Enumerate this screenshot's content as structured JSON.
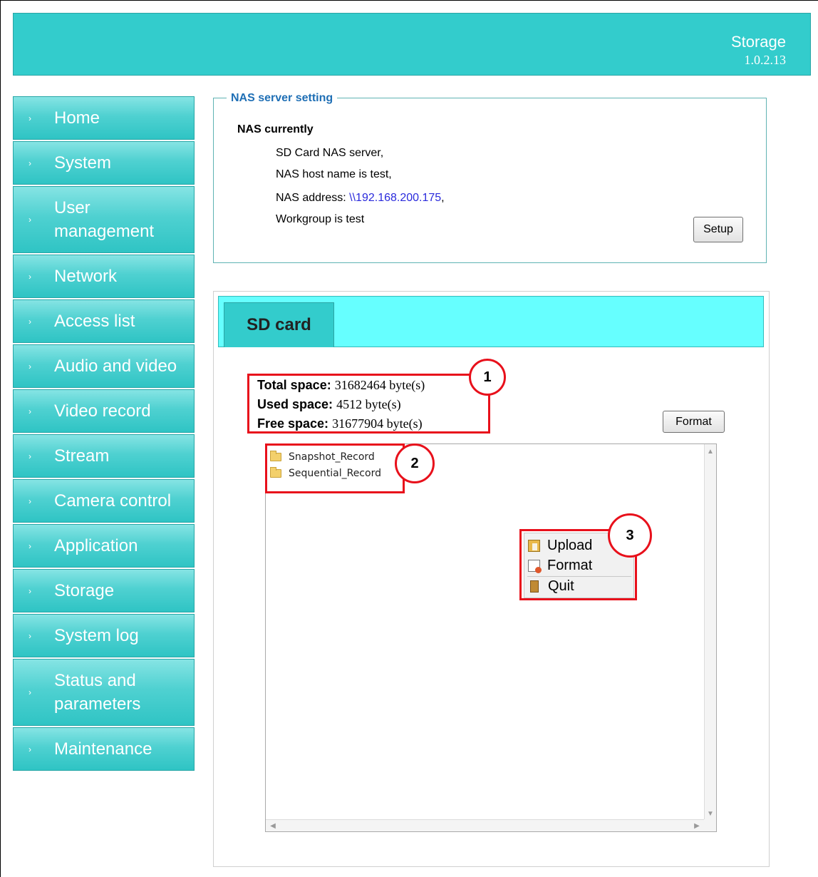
{
  "header": {
    "title": "Storage",
    "version": "1.0.2.13",
    "bg_color": "#33cccc"
  },
  "sidebar": {
    "items": [
      {
        "label": "Home"
      },
      {
        "label": "System"
      },
      {
        "label": "User management"
      },
      {
        "label": "Network"
      },
      {
        "label": "Access list"
      },
      {
        "label": "Audio and video"
      },
      {
        "label": "Video record"
      },
      {
        "label": "Stream"
      },
      {
        "label": "Camera control"
      },
      {
        "label": "Application"
      },
      {
        "label": "Storage"
      },
      {
        "label": "System log"
      },
      {
        "label": "Status and parameters"
      },
      {
        "label": "Maintenance"
      }
    ],
    "chevron_icon": "chevron-right-icon"
  },
  "nas": {
    "legend": "NAS server setting",
    "heading": "NAS currently",
    "line1": "SD Card NAS server,",
    "line2": "NAS host name is test,",
    "line3_prefix": "NAS address: ",
    "line3_link": "\\\\192.168.200.175",
    "line3_suffix": ",",
    "line4": "Workgroup is test",
    "setup_button": "Setup"
  },
  "sd_card": {
    "tab_label": "SD card",
    "total_label": "Total space:",
    "total_value": "31682464 byte(s)",
    "used_label": "Used space:",
    "used_value": "4512 byte(s)",
    "free_label": "Free space:",
    "free_value": "31677904 byte(s)",
    "format_button": "Format",
    "folders": [
      {
        "name": "Snapshot_Record",
        "icon": "folder-icon"
      },
      {
        "name": "Sequential_Record",
        "icon": "folder-icon"
      }
    ]
  },
  "context_menu": {
    "items": [
      {
        "label": "Upload",
        "icon": "upload-icon"
      },
      {
        "label": "Format",
        "icon": "format-icon"
      },
      {
        "label": "Quit",
        "icon": "quit-icon"
      }
    ]
  },
  "callouts": {
    "one": "1",
    "two": "2",
    "three": "3",
    "color": "#e8101b"
  }
}
